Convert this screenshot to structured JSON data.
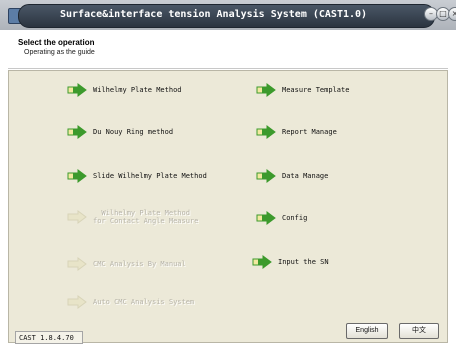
{
  "window": {
    "title": "Surface&interface tension Analysis System (CAST1.0)"
  },
  "header": {
    "title": "Select the operation",
    "subtitle": "Operating as the guide"
  },
  "menu_left": [
    {
      "label": "Wilhelmy Plate Method",
      "enabled": true
    },
    {
      "label": "Du Nouy Ring method",
      "enabled": true
    },
    {
      "label": "Slide Wilhelmy Plate Method",
      "enabled": true
    },
    {
      "label": "Wilhelmy Plate Method\nfor Contact Angle Measure",
      "enabled": false
    },
    {
      "label": "CMC Analysis By Manual",
      "enabled": false
    },
    {
      "label": "Auto CMC Analysis System",
      "enabled": false
    }
  ],
  "menu_right": [
    {
      "label": "Measure Template",
      "enabled": true
    },
    {
      "label": "Report Manage",
      "enabled": true
    },
    {
      "label": "Data Manage",
      "enabled": true
    },
    {
      "label": "Config",
      "enabled": true
    },
    {
      "label": "Input the SN",
      "enabled": true
    }
  ],
  "footer": {
    "version": "CAST 1.8.4.70",
    "english_button": "English",
    "chinese_button": "中文"
  },
  "colors": {
    "arrow_green": "#3c9a2c",
    "arrow_yellow": "#f2e9a0",
    "panel_bg": "#ece9d8"
  }
}
